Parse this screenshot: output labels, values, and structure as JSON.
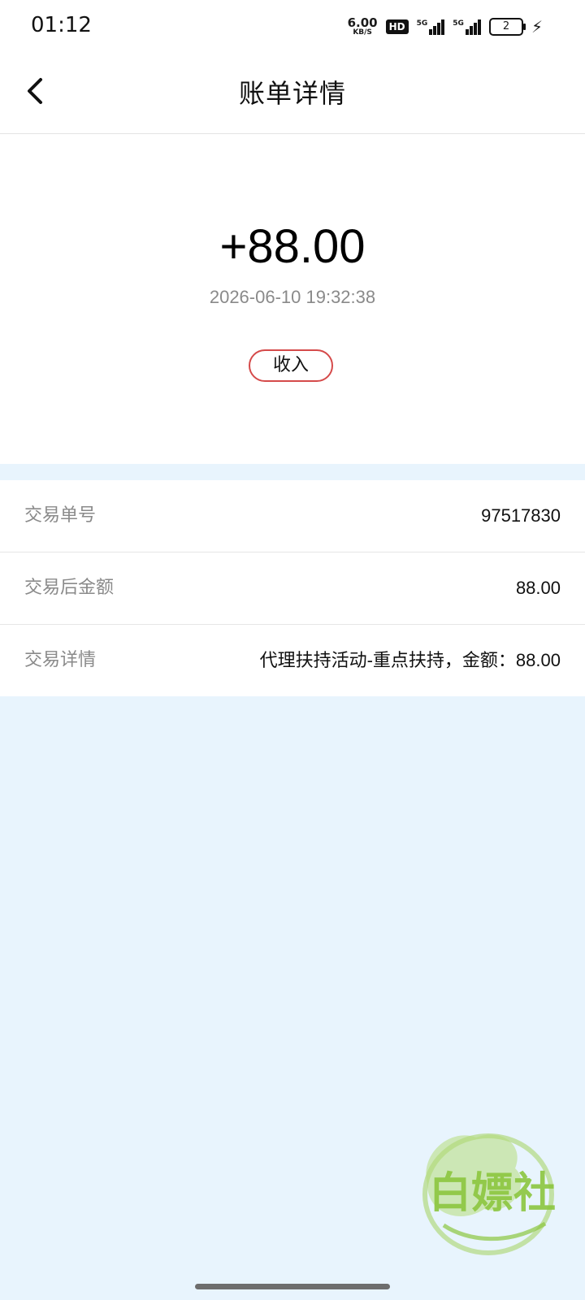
{
  "status_bar": {
    "time": "01:12",
    "net_speed_value": "6.00",
    "net_speed_unit": "KB/S",
    "hd_label": "HD",
    "signal_1_label": "5G",
    "signal_2_label": "5G",
    "battery_level": "2",
    "icons": [
      "hd-icon",
      "signal-icon",
      "signal-icon",
      "battery-icon",
      "charging-icon"
    ]
  },
  "nav": {
    "title": "账单详情",
    "back_icon": "chevron-left-icon"
  },
  "summary": {
    "amount": "+88.00",
    "datetime": "2026-06-10 19:32:38",
    "type_label": "收入",
    "badge_color": "#d54a4a"
  },
  "details": {
    "rows": [
      {
        "label": "交易单号",
        "value": "97517830"
      },
      {
        "label": "交易后金额",
        "value": "88.00"
      },
      {
        "label": "交易详情",
        "value": "代理扶持活动-重点扶持，金额：88.00"
      }
    ]
  },
  "watermark": {
    "text": "白嫖社",
    "color": "#8cc63f"
  },
  "colors": {
    "background": "#e8f4fd",
    "card": "#ffffff",
    "muted_text": "#8a8a8a"
  }
}
